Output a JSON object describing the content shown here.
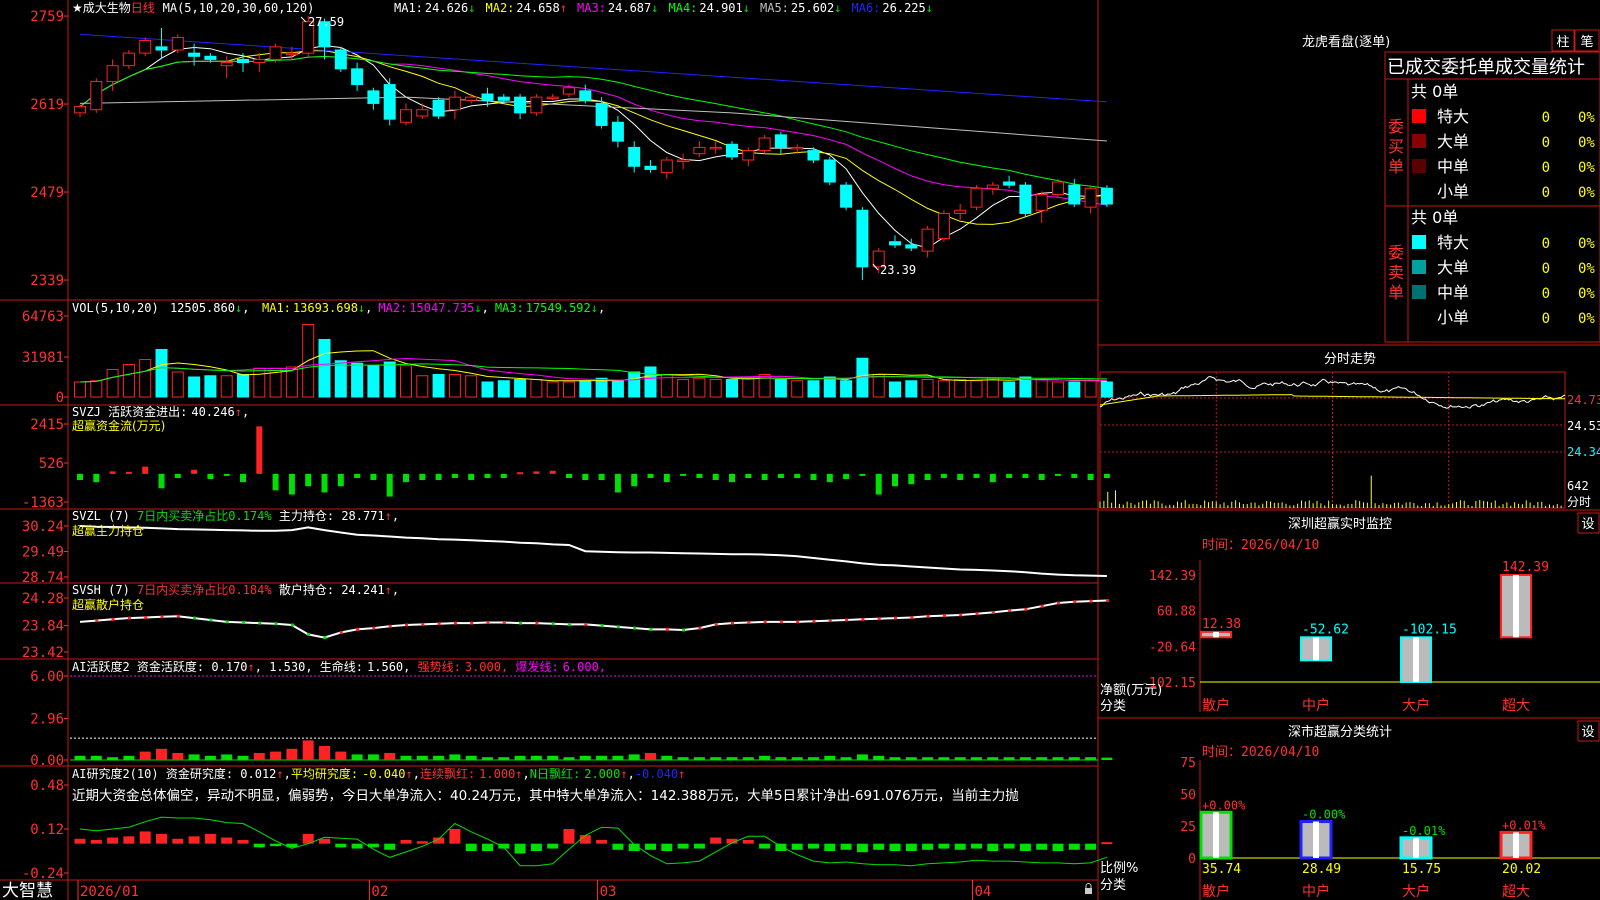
{
  "stock": {
    "name": "成大生物",
    "prefix": "★",
    "period": "日线",
    "star_visible": true
  },
  "colors": {
    "up": "#ff2222",
    "down": "#00ffff",
    "ma1": "#ffffff",
    "ma2": "#ffff00",
    "ma3": "#ff00ff",
    "ma4": "#00ff00",
    "ma5": "#c0c0c0",
    "ma6": "#2222ff",
    "frame": "#c81818",
    "label_red": "#ff3030",
    "green": "#00e000"
  },
  "header": {
    "ma_label": "MA(5,10,20,30,60,120)",
    "ma_items": [
      {
        "name": "MA1:",
        "value": "24.626",
        "arrow": "↓",
        "color": "#ffffff"
      },
      {
        "name": "MA2:",
        "value": "24.658",
        "arrow": "↑",
        "color": "#ffff00"
      },
      {
        "name": "MA3:",
        "value": "24.687",
        "arrow": "↓",
        "color": "#ff00ff"
      },
      {
        "name": "MA4:",
        "value": "24.901",
        "arrow": "↓",
        "color": "#00ff00"
      },
      {
        "name": "MA5:",
        "value": "25.602",
        "arrow": "↓",
        "color": "#c0c0c0"
      },
      {
        "name": "MA6:",
        "value": "26.225",
        "arrow": "↓",
        "color": "#2222ff"
      }
    ]
  },
  "panels": {
    "price": {
      "y_ticks": [
        "2759",
        "2619",
        "2479",
        "2339"
      ],
      "high_label": "27.59",
      "low_label": "23.39"
    },
    "vol": {
      "title": "VOL(5,10,20)",
      "value": "12505.860",
      "value_arrow": "↓",
      "ma_items": [
        {
          "name": "MA1:",
          "value": "13693.698",
          "arrow": "↓",
          "color": "#ffff00"
        },
        {
          "name": "MA2:",
          "value": "15047.735",
          "arrow": "↓",
          "color": "#ff00ff"
        },
        {
          "name": "MA3:",
          "value": "17549.592",
          "arrow": "↓",
          "color": "#00ff00"
        }
      ],
      "y_ticks": [
        "64763",
        "31981",
        "0"
      ]
    },
    "svzj": {
      "line1_prefix": "SVZJ  活跃资金进出:",
      "line1_value": "40.246",
      "line1_arrow": "↑",
      "line1_suffix": ",",
      "line2": "超赢资金流(万元)",
      "y_ticks": [
        "2415",
        "526",
        "-1363"
      ]
    },
    "svzl": {
      "prefix": "SVZL (7)",
      "ratio_label": "7日内买卖净占比0.174%",
      "main_label": "主力持仓:",
      "main_value": "28.771",
      "main_arrow": "↑",
      "suffix": ",",
      "line2": "超赢主力持仓",
      "y_ticks": [
        "30.24",
        "29.49",
        "28.74"
      ]
    },
    "svsh": {
      "prefix": "SVSH (7)",
      "ratio_label": "7日内买卖净占比0.184%",
      "main_label": "散户持仓:",
      "main_value": "24.241",
      "main_arrow": "↑",
      "suffix": ",",
      "line2": "超赢散户持仓",
      "y_ticks": [
        "24.28",
        "23.84",
        "23.42"
      ]
    },
    "ai1": {
      "title": "AI活跃度2",
      "text1": "资金活跃度:",
      "v1": "0.170",
      "a1": "↑",
      "v2": "1.530",
      "text3": "生命线:",
      "v3": "1.560,",
      "text4": "强势线:",
      "v4": "3.000,",
      "text5": "爆发线:",
      "v5": "6.000,",
      "y_ticks": [
        "6.00",
        "2.96",
        "0.00"
      ]
    },
    "ai2": {
      "title": "AI研究度2(10)",
      "text1": "资金研究度:",
      "v1": "0.012",
      "a1": "↑",
      "text2": "平均研究度:",
      "v2": "-0.040",
      "a2": "↑",
      "text3": "连续飘红:",
      "v3": "1.000",
      "a3": "↑",
      "text4": "N日飘红:",
      "v4": "2.000",
      "a4": "↑",
      "v5": "-0.040",
      "a5": "↑",
      "note": "近期大资金总体偏空，异动不明显，偏弱势，今日大单净流入：40.24万元，其中特大单净流入：142.388万元，大单5日累计净出-691.076万元，当前主力抛",
      "y_ticks": [
        "0.48",
        "0.12",
        "-0.24"
      ]
    }
  },
  "x_axis": {
    "labels": [
      "2026/01",
      "02",
      "03",
      "04"
    ]
  },
  "footer": {
    "brand": "大智慧"
  },
  "right_panel": {
    "dragon_title": "龙虎看盘(逐单)",
    "tab_zhu": "柱",
    "tab_bi": "笔",
    "stat_title": "已成交委托单成交量统计",
    "buy_group": {
      "side_label": "委买单",
      "total": "共 0单",
      "rows": [
        {
          "label": "特大",
          "count": "0",
          "pct": "0%",
          "color": "#ff0000"
        },
        {
          "label": "大单",
          "count": "0",
          "pct": "0%",
          "color": "#8b0000"
        },
        {
          "label": "中单",
          "count": "0",
          "pct": "0%",
          "color": "#5a0000"
        },
        {
          "label": "小单",
          "count": "0",
          "pct": "0%",
          "color": ""
        }
      ]
    },
    "sell_group": {
      "side_label": "委卖单",
      "total": "共 0单",
      "rows": [
        {
          "label": "特大",
          "count": "0",
          "pct": "0%",
          "color": "#00ffff"
        },
        {
          "label": "大单",
          "count": "0",
          "pct": "0%",
          "color": "#00a0a0"
        },
        {
          "label": "中单",
          "count": "0",
          "pct": "0%",
          "color": "#007070"
        },
        {
          "label": "小单",
          "count": "0",
          "pct": "0%",
          "color": ""
        }
      ]
    },
    "intraday_title": "分时走势",
    "intraday_ticks": [
      "24.73",
      "24.53",
      "24.34",
      "642"
    ],
    "intraday_footer": "分时",
    "monitor": {
      "title": "深圳超赢实时监控",
      "button": "设",
      "time_label": "时间：",
      "time_value": "2026/04/10",
      "y_ticks": [
        "142.39",
        "60.88",
        "-20.64",
        "-102.15"
      ],
      "ylabel": "净额(万元)",
      "xlabel": "分类",
      "categories": [
        "散户",
        "中户",
        "大户",
        "超大"
      ],
      "values": [
        12.38,
        -52.62,
        -102.15,
        142.39
      ],
      "value_labels": [
        "12.38",
        "-52.62",
        "-102.15",
        "142.39"
      ]
    },
    "classification": {
      "title": "深市超赢分类统计",
      "button": "设",
      "time_label": "时间：",
      "time_value": "2026/04/10",
      "y_ticks": [
        "75",
        "50",
        "25",
        "0"
      ],
      "ylabel": "比例%",
      "xlabel": "分类",
      "categories": [
        "散户",
        "中户",
        "大户",
        "超大"
      ],
      "values": [
        35.74,
        28.49,
        15.75,
        20.02
      ],
      "change_labels": [
        "+0.00%",
        "-0.00%",
        "-0.01%",
        "+0.01%"
      ]
    }
  },
  "chart_data": [
    {
      "type": "candlestick",
      "title": "成大生物 日线",
      "x_ticks": [
        "2026/01",
        "02",
        "03",
        "04"
      ],
      "ylim": [
        23.2,
        27.75
      ],
      "ohlc": [
        [
          26.05,
          26.18,
          25.98,
          26.15
        ],
        [
          26.1,
          26.6,
          26.05,
          26.55
        ],
        [
          26.55,
          26.9,
          26.4,
          26.8
        ],
        [
          26.8,
          27.05,
          26.75,
          27.0
        ],
        [
          27.0,
          27.25,
          26.95,
          27.2
        ],
        [
          27.1,
          27.4,
          26.9,
          27.05
        ],
        [
          27.05,
          27.3,
          27.0,
          27.25
        ],
        [
          27.0,
          27.15,
          26.8,
          26.95
        ],
        [
          26.95,
          27.0,
          26.85,
          26.9
        ],
        [
          26.8,
          26.95,
          26.6,
          26.85
        ],
        [
          26.9,
          27.0,
          26.7,
          26.85
        ],
        [
          26.85,
          27.0,
          26.7,
          26.9
        ],
        [
          26.9,
          27.15,
          26.85,
          27.1
        ],
        [
          27.0,
          27.1,
          26.9,
          27.0
        ],
        [
          27.0,
          27.59,
          26.95,
          27.5
        ],
        [
          27.5,
          27.55,
          26.9,
          27.1
        ],
        [
          27.05,
          27.1,
          26.7,
          26.75
        ],
        [
          26.75,
          26.85,
          26.4,
          26.5
        ],
        [
          26.4,
          26.45,
          26.1,
          26.2
        ],
        [
          26.5,
          26.6,
          25.85,
          25.95
        ],
        [
          25.9,
          26.2,
          25.85,
          26.1
        ],
        [
          26.0,
          26.2,
          25.95,
          26.1
        ],
        [
          26.25,
          26.3,
          25.95,
          26.0
        ],
        [
          26.1,
          26.4,
          25.95,
          26.3
        ],
        [
          26.25,
          26.35,
          26.2,
          26.3
        ],
        [
          26.35,
          26.45,
          26.15,
          26.25
        ],
        [
          26.3,
          26.35,
          26.2,
          26.25
        ],
        [
          26.3,
          26.35,
          25.95,
          26.05
        ],
        [
          26.05,
          26.35,
          26.0,
          26.3
        ],
        [
          26.3,
          26.35,
          26.25,
          26.3
        ],
        [
          26.35,
          26.5,
          26.3,
          26.45
        ],
        [
          26.4,
          26.5,
          26.2,
          26.25
        ],
        [
          26.2,
          26.3,
          25.8,
          25.85
        ],
        [
          25.9,
          26.0,
          25.5,
          25.6
        ],
        [
          25.5,
          25.6,
          25.1,
          25.2
        ],
        [
          25.2,
          25.3,
          25.1,
          25.15
        ],
        [
          25.1,
          25.35,
          25.0,
          25.3
        ],
        [
          25.3,
          25.4,
          25.15,
          25.3
        ],
        [
          25.4,
          25.6,
          25.35,
          25.5
        ],
        [
          25.5,
          25.6,
          25.4,
          25.5
        ],
        [
          25.55,
          25.6,
          25.3,
          25.35
        ],
        [
          25.3,
          25.5,
          25.2,
          25.45
        ],
        [
          25.45,
          25.7,
          25.4,
          25.65
        ],
        [
          25.7,
          25.75,
          25.4,
          25.5
        ],
        [
          25.5,
          25.55,
          25.4,
          25.5
        ],
        [
          25.45,
          25.5,
          25.25,
          25.3
        ],
        [
          25.3,
          25.35,
          24.9,
          24.95
        ],
        [
          24.9,
          24.95,
          24.5,
          24.55
        ],
        [
          24.5,
          24.55,
          23.39,
          23.6
        ],
        [
          23.6,
          23.9,
          23.5,
          23.85
        ],
        [
          24.0,
          24.1,
          23.9,
          23.95
        ],
        [
          23.95,
          24.05,
          23.85,
          23.9
        ],
        [
          23.85,
          24.25,
          23.75,
          24.2
        ],
        [
          24.05,
          24.5,
          24.0,
          24.45
        ],
        [
          24.45,
          24.6,
          24.35,
          24.5
        ],
        [
          24.55,
          24.9,
          24.5,
          24.85
        ],
        [
          24.85,
          24.95,
          24.75,
          24.9
        ],
        [
          24.95,
          25.05,
          24.85,
          24.9
        ],
        [
          24.9,
          24.95,
          24.4,
          24.45
        ],
        [
          24.5,
          24.8,
          24.3,
          24.75
        ],
        [
          24.75,
          25.0,
          24.7,
          24.95
        ],
        [
          24.9,
          25.0,
          24.55,
          24.6
        ],
        [
          24.55,
          24.9,
          24.45,
          24.85
        ],
        [
          24.85,
          24.9,
          24.55,
          24.6
        ]
      ]
    },
    {
      "type": "bar",
      "title": "VOL(5,10,20)",
      "ylim": [
        0,
        64763
      ],
      "values": [
        12000,
        13000,
        22000,
        26000,
        30000,
        38000,
        20000,
        16000,
        17000,
        17000,
        18000,
        23000,
        23000,
        24000,
        58000,
        46000,
        29000,
        27000,
        25000,
        28000,
        25000,
        17000,
        18000,
        18000,
        17000,
        12000,
        13000,
        14000,
        14000,
        12000,
        12000,
        13000,
        15000,
        13000,
        20000,
        24000,
        18000,
        14000,
        15000,
        14000,
        14000,
        15000,
        18000,
        14000,
        13000,
        13000,
        16000,
        13000,
        31000,
        18000,
        12000,
        13000,
        14000,
        13000,
        14000,
        13000,
        15000,
        12000,
        16000,
        14000,
        12000,
        12000,
        13000,
        12000
      ]
    },
    {
      "type": "bar",
      "title": "超赢资金流(万元)",
      "ylim": [
        -1363,
        2415
      ],
      "values": [
        -300,
        -400,
        120,
        100,
        350,
        -700,
        -200,
        200,
        -250,
        -100,
        -400,
        2300,
        -800,
        -1000,
        -600,
        -900,
        -600,
        -200,
        -300,
        -1100,
        -400,
        -300,
        -300,
        -200,
        -300,
        -200,
        -200,
        80,
        120,
        150,
        -200,
        -300,
        -300,
        -900,
        -600,
        -200,
        -400,
        -100,
        -200,
        -300,
        -400,
        -200,
        -300,
        -200,
        -200,
        -300,
        -400,
        -250,
        -100,
        -1000,
        -600,
        -500,
        -300,
        -200,
        -300,
        -200,
        -400,
        -200,
        -200,
        -300,
        -100,
        -200,
        -300,
        -200
      ]
    },
    {
      "type": "line",
      "title": "超赢主力持仓",
      "ylim": [
        28.74,
        30.24
      ],
      "values": [
        30.24,
        30.22,
        30.21,
        30.2,
        30.19,
        30.17,
        30.15,
        30.14,
        30.13,
        30.12,
        30.11,
        30.1,
        30.1,
        30.12,
        30.2,
        30.12,
        30.05,
        29.98,
        29.96,
        29.93,
        29.9,
        29.88,
        29.85,
        29.84,
        29.82,
        29.8,
        29.78,
        29.75,
        29.73,
        29.7,
        29.68,
        29.5,
        29.48,
        29.47,
        29.46,
        29.46,
        29.45,
        29.44,
        29.43,
        29.42,
        29.41,
        29.41,
        29.4,
        29.38,
        29.35,
        29.3,
        29.25,
        29.2,
        29.14,
        29.1,
        29.08,
        29.05,
        29.02,
        28.99,
        28.96,
        28.95,
        28.93,
        28.91,
        28.88,
        28.84,
        28.81,
        28.79,
        28.78,
        28.77
      ]
    },
    {
      "type": "line",
      "title": "超赢散户持仓",
      "ylim": [
        23.42,
        24.28
      ],
      "values": [
        23.9,
        23.92,
        23.94,
        23.96,
        23.97,
        23.98,
        23.99,
        23.96,
        23.93,
        23.9,
        23.89,
        23.88,
        23.87,
        23.85,
        23.7,
        23.65,
        23.73,
        23.78,
        23.8,
        23.83,
        23.85,
        23.86,
        23.87,
        23.88,
        23.88,
        23.89,
        23.89,
        23.88,
        23.88,
        23.87,
        23.86,
        23.86,
        23.84,
        23.82,
        23.8,
        23.78,
        23.78,
        23.77,
        23.8,
        23.86,
        23.88,
        23.89,
        23.9,
        23.9,
        23.9,
        23.91,
        23.92,
        23.93,
        23.94,
        23.95,
        23.96,
        23.97,
        23.99,
        24.0,
        24.01,
        24.03,
        24.05,
        24.08,
        24.1,
        24.15,
        24.2,
        24.22,
        24.23,
        24.24
      ]
    },
    {
      "type": "bar",
      "title": "AI活跃度2",
      "ylim": [
        0,
        6.0
      ],
      "values": [
        0.3,
        0.3,
        0.2,
        0.3,
        0.6,
        0.8,
        0.5,
        0.4,
        0.3,
        0.4,
        0.3,
        0.5,
        0.6,
        0.8,
        1.4,
        1.0,
        0.6,
        0.4,
        0.4,
        0.5,
        0.3,
        0.3,
        0.3,
        0.4,
        0.3,
        0.2,
        0.2,
        0.3,
        0.3,
        0.3,
        0.2,
        0.3,
        0.3,
        0.3,
        0.4,
        0.5,
        0.3,
        0.2,
        0.2,
        0.2,
        0.2,
        0.2,
        0.3,
        0.2,
        0.2,
        0.2,
        0.3,
        0.2,
        0.4,
        0.3,
        0.2,
        0.2,
        0.2,
        0.2,
        0.2,
        0.2,
        0.2,
        0.2,
        0.2,
        0.2,
        0.2,
        0.2,
        0.2,
        0.17
      ]
    },
    {
      "type": "bar",
      "title": "AI研究度2(10)",
      "ylim": [
        -0.24,
        0.48
      ],
      "values": [
        0.04,
        0.03,
        0.05,
        0.06,
        0.1,
        0.08,
        0.04,
        0.06,
        0.08,
        0.05,
        0.03,
        -0.03,
        -0.02,
        -0.03,
        0.08,
        0.04,
        -0.03,
        -0.04,
        -0.03,
        -0.05,
        0.03,
        0.02,
        0.05,
        0.12,
        -0.06,
        -0.06,
        -0.04,
        -0.08,
        -0.06,
        -0.04,
        0.12,
        0.07,
        0.03,
        -0.05,
        -0.06,
        -0.05,
        -0.06,
        -0.04,
        -0.04,
        0.05,
        0.04,
        0.03,
        -0.04,
        -0.06,
        -0.05,
        -0.04,
        -0.06,
        -0.05,
        -0.07,
        -0.05,
        -0.06,
        -0.06,
        -0.05,
        -0.04,
        -0.05,
        -0.04,
        -0.06,
        -0.04,
        -0.06,
        -0.05,
        -0.06,
        -0.05,
        -0.05,
        0.012
      ]
    },
    {
      "type": "bar",
      "title": "深圳超赢实时监控",
      "categories": [
        "散户",
        "中户",
        "大户",
        "超大"
      ],
      "values": [
        12.38,
        -52.62,
        -102.15,
        142.39
      ],
      "ylabel": "净额(万元)",
      "xlabel": "分类",
      "ylim": [
        -102.15,
        142.39
      ]
    },
    {
      "type": "bar",
      "title": "深市超赢分类统计",
      "categories": [
        "散户",
        "中户",
        "大户",
        "超大"
      ],
      "values": [
        35.74,
        28.49,
        15.75,
        20.02
      ],
      "ylabel": "比例%",
      "xlabel": "分类",
      "ylim": [
        0,
        75
      ]
    }
  ]
}
